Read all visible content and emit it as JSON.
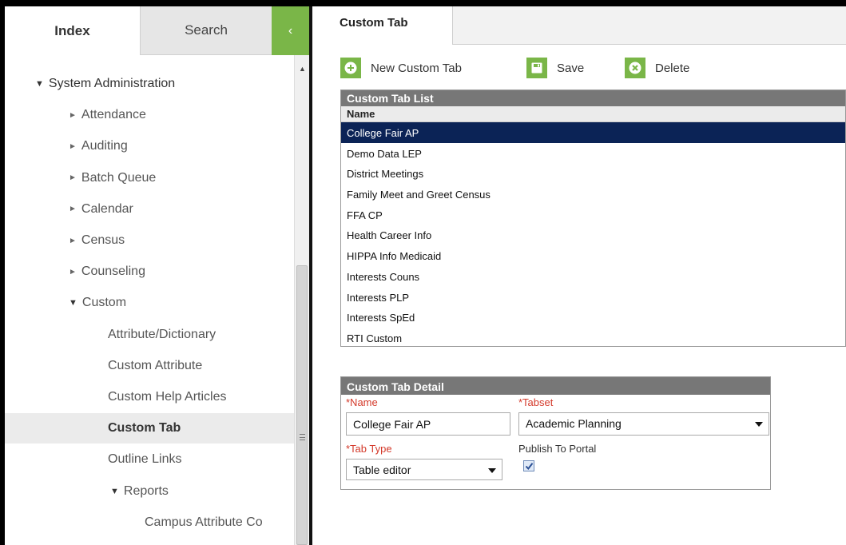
{
  "nav": {
    "tabs": {
      "index": "Index",
      "search": "Search"
    },
    "collapse_icon": "‹",
    "tree": [
      {
        "label": "System Administration",
        "arrow": "▼",
        "level": 0
      },
      {
        "label": "Attendance",
        "arrow": "►",
        "level": 1
      },
      {
        "label": "Auditing",
        "arrow": "►",
        "level": 1
      },
      {
        "label": "Batch Queue",
        "arrow": "►",
        "level": 1
      },
      {
        "label": "Calendar",
        "arrow": "►",
        "level": 1
      },
      {
        "label": "Census",
        "arrow": "►",
        "level": 1
      },
      {
        "label": "Counseling",
        "arrow": "►",
        "level": 1
      },
      {
        "label": "Custom",
        "arrow": "▼",
        "level": 1
      },
      {
        "label": "Attribute/Dictionary",
        "arrow": "",
        "level": 2
      },
      {
        "label": "Custom Attribute",
        "arrow": "",
        "level": 2
      },
      {
        "label": "Custom Help Articles",
        "arrow": "",
        "level": 2
      },
      {
        "label": "Custom Tab",
        "arrow": "",
        "level": 2,
        "active": true
      },
      {
        "label": "Outline Links",
        "arrow": "",
        "level": 2
      },
      {
        "label": "Reports",
        "arrow": "▼",
        "level": 2
      },
      {
        "label": "Campus Attribute Co",
        "arrow": "",
        "level": 3
      }
    ]
  },
  "main": {
    "tab_label": "Custom Tab",
    "toolbar": {
      "new_label": "New Custom Tab",
      "save_label": "Save",
      "delete_label": "Delete"
    },
    "list": {
      "title": "Custom Tab List",
      "column": "Name",
      "rows": [
        "College Fair AP",
        "Demo Data LEP",
        "District Meetings",
        "Family Meet and Greet Census",
        "FFA CP",
        "Health Career Info",
        "HIPPA Info Medicaid",
        "Interests Couns",
        "Interests PLP",
        "Interests SpEd",
        "RTI Custom"
      ],
      "selected_index": 0
    },
    "detail": {
      "title": "Custom Tab Detail",
      "name_label": "*Name",
      "name_value": "College Fair AP",
      "tabset_label": "*Tabset",
      "tabset_value": "Academic Planning",
      "tabtype_label": "*Tab Type",
      "tabtype_value": "Table editor",
      "publish_label": "Publish To Portal",
      "publish_checked": true
    }
  },
  "colors": {
    "accent_green": "#7ab648",
    "selected_row": "#0b2356",
    "header_gray": "#777777",
    "required_red": "#d43a2b"
  },
  "icons": {
    "new": "plus-circle-icon",
    "save": "floppy-disk-icon",
    "delete": "x-circle-icon"
  }
}
